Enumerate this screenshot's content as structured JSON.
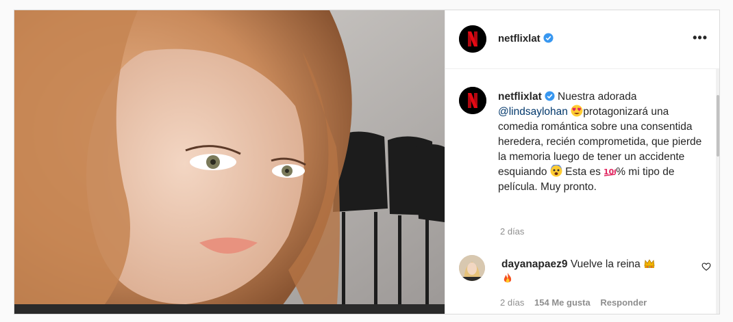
{
  "post": {
    "account": {
      "username": "netflixlat",
      "verified": true,
      "avatar_icon": "netflix-n-logo"
    },
    "more_icon_label": "•••",
    "caption": {
      "username": "netflixlat",
      "lines": {
        "l1": "Nuestra adorada",
        "mention": "@lindsaylohan",
        "l2": "protagonizará una comedia romántica sobre una consentida heredera, recién comprometida, que pierde la memoria luego de tener un accidente esquiando",
        "l3": "Esta es",
        "l4": "% mi tipo de película. Muy pronto."
      },
      "emojis": [
        "heart-eyes-emoji",
        "fearful-face-emoji",
        "hundred-points-emoji"
      ],
      "time": "2 días"
    },
    "comments": [
      {
        "username": "dayanapaez9",
        "text": "Vuelve la reina",
        "emojis": [
          "crown-emoji",
          "fire-emoji"
        ],
        "time": "2 días",
        "likes": "154 Me gusta",
        "reply_label": "Responder"
      }
    ]
  },
  "colors": {
    "text": "#262626",
    "muted": "#8e8e8e",
    "mention": "#00376b",
    "verified": "#3897f0",
    "netflix_red": "#e50914"
  }
}
